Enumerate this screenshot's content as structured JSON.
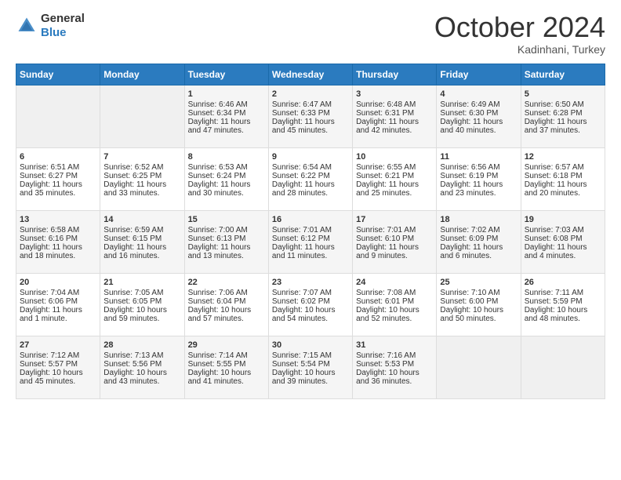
{
  "header": {
    "logo_line1": "General",
    "logo_line2": "Blue",
    "month": "October 2024",
    "location": "Kadinhani, Turkey"
  },
  "weekdays": [
    "Sunday",
    "Monday",
    "Tuesday",
    "Wednesday",
    "Thursday",
    "Friday",
    "Saturday"
  ],
  "weeks": [
    [
      {
        "day": "",
        "sunrise": "",
        "sunset": "",
        "daylight": ""
      },
      {
        "day": "",
        "sunrise": "",
        "sunset": "",
        "daylight": ""
      },
      {
        "day": "1",
        "sunrise": "Sunrise: 6:46 AM",
        "sunset": "Sunset: 6:34 PM",
        "daylight": "Daylight: 11 hours and 47 minutes."
      },
      {
        "day": "2",
        "sunrise": "Sunrise: 6:47 AM",
        "sunset": "Sunset: 6:33 PM",
        "daylight": "Daylight: 11 hours and 45 minutes."
      },
      {
        "day": "3",
        "sunrise": "Sunrise: 6:48 AM",
        "sunset": "Sunset: 6:31 PM",
        "daylight": "Daylight: 11 hours and 42 minutes."
      },
      {
        "day": "4",
        "sunrise": "Sunrise: 6:49 AM",
        "sunset": "Sunset: 6:30 PM",
        "daylight": "Daylight: 11 hours and 40 minutes."
      },
      {
        "day": "5",
        "sunrise": "Sunrise: 6:50 AM",
        "sunset": "Sunset: 6:28 PM",
        "daylight": "Daylight: 11 hours and 37 minutes."
      }
    ],
    [
      {
        "day": "6",
        "sunrise": "Sunrise: 6:51 AM",
        "sunset": "Sunset: 6:27 PM",
        "daylight": "Daylight: 11 hours and 35 minutes."
      },
      {
        "day": "7",
        "sunrise": "Sunrise: 6:52 AM",
        "sunset": "Sunset: 6:25 PM",
        "daylight": "Daylight: 11 hours and 33 minutes."
      },
      {
        "day": "8",
        "sunrise": "Sunrise: 6:53 AM",
        "sunset": "Sunset: 6:24 PM",
        "daylight": "Daylight: 11 hours and 30 minutes."
      },
      {
        "day": "9",
        "sunrise": "Sunrise: 6:54 AM",
        "sunset": "Sunset: 6:22 PM",
        "daylight": "Daylight: 11 hours and 28 minutes."
      },
      {
        "day": "10",
        "sunrise": "Sunrise: 6:55 AM",
        "sunset": "Sunset: 6:21 PM",
        "daylight": "Daylight: 11 hours and 25 minutes."
      },
      {
        "day": "11",
        "sunrise": "Sunrise: 6:56 AM",
        "sunset": "Sunset: 6:19 PM",
        "daylight": "Daylight: 11 hours and 23 minutes."
      },
      {
        "day": "12",
        "sunrise": "Sunrise: 6:57 AM",
        "sunset": "Sunset: 6:18 PM",
        "daylight": "Daylight: 11 hours and 20 minutes."
      }
    ],
    [
      {
        "day": "13",
        "sunrise": "Sunrise: 6:58 AM",
        "sunset": "Sunset: 6:16 PM",
        "daylight": "Daylight: 11 hours and 18 minutes."
      },
      {
        "day": "14",
        "sunrise": "Sunrise: 6:59 AM",
        "sunset": "Sunset: 6:15 PM",
        "daylight": "Daylight: 11 hours and 16 minutes."
      },
      {
        "day": "15",
        "sunrise": "Sunrise: 7:00 AM",
        "sunset": "Sunset: 6:13 PM",
        "daylight": "Daylight: 11 hours and 13 minutes."
      },
      {
        "day": "16",
        "sunrise": "Sunrise: 7:01 AM",
        "sunset": "Sunset: 6:12 PM",
        "daylight": "Daylight: 11 hours and 11 minutes."
      },
      {
        "day": "17",
        "sunrise": "Sunrise: 7:01 AM",
        "sunset": "Sunset: 6:10 PM",
        "daylight": "Daylight: 11 hours and 9 minutes."
      },
      {
        "day": "18",
        "sunrise": "Sunrise: 7:02 AM",
        "sunset": "Sunset: 6:09 PM",
        "daylight": "Daylight: 11 hours and 6 minutes."
      },
      {
        "day": "19",
        "sunrise": "Sunrise: 7:03 AM",
        "sunset": "Sunset: 6:08 PM",
        "daylight": "Daylight: 11 hours and 4 minutes."
      }
    ],
    [
      {
        "day": "20",
        "sunrise": "Sunrise: 7:04 AM",
        "sunset": "Sunset: 6:06 PM",
        "daylight": "Daylight: 11 hours and 1 minute."
      },
      {
        "day": "21",
        "sunrise": "Sunrise: 7:05 AM",
        "sunset": "Sunset: 6:05 PM",
        "daylight": "Daylight: 10 hours and 59 minutes."
      },
      {
        "day": "22",
        "sunrise": "Sunrise: 7:06 AM",
        "sunset": "Sunset: 6:04 PM",
        "daylight": "Daylight: 10 hours and 57 minutes."
      },
      {
        "day": "23",
        "sunrise": "Sunrise: 7:07 AM",
        "sunset": "Sunset: 6:02 PM",
        "daylight": "Daylight: 10 hours and 54 minutes."
      },
      {
        "day": "24",
        "sunrise": "Sunrise: 7:08 AM",
        "sunset": "Sunset: 6:01 PM",
        "daylight": "Daylight: 10 hours and 52 minutes."
      },
      {
        "day": "25",
        "sunrise": "Sunrise: 7:10 AM",
        "sunset": "Sunset: 6:00 PM",
        "daylight": "Daylight: 10 hours and 50 minutes."
      },
      {
        "day": "26",
        "sunrise": "Sunrise: 7:11 AM",
        "sunset": "Sunset: 5:59 PM",
        "daylight": "Daylight: 10 hours and 48 minutes."
      }
    ],
    [
      {
        "day": "27",
        "sunrise": "Sunrise: 7:12 AM",
        "sunset": "Sunset: 5:57 PM",
        "daylight": "Daylight: 10 hours and 45 minutes."
      },
      {
        "day": "28",
        "sunrise": "Sunrise: 7:13 AM",
        "sunset": "Sunset: 5:56 PM",
        "daylight": "Daylight: 10 hours and 43 minutes."
      },
      {
        "day": "29",
        "sunrise": "Sunrise: 7:14 AM",
        "sunset": "Sunset: 5:55 PM",
        "daylight": "Daylight: 10 hours and 41 minutes."
      },
      {
        "day": "30",
        "sunrise": "Sunrise: 7:15 AM",
        "sunset": "Sunset: 5:54 PM",
        "daylight": "Daylight: 10 hours and 39 minutes."
      },
      {
        "day": "31",
        "sunrise": "Sunrise: 7:16 AM",
        "sunset": "Sunset: 5:53 PM",
        "daylight": "Daylight: 10 hours and 36 minutes."
      },
      {
        "day": "",
        "sunrise": "",
        "sunset": "",
        "daylight": ""
      },
      {
        "day": "",
        "sunrise": "",
        "sunset": "",
        "daylight": ""
      }
    ]
  ]
}
